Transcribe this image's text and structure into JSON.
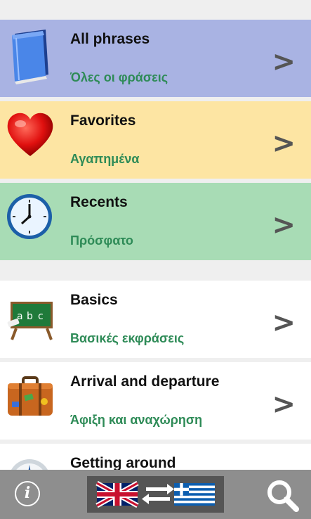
{
  "list": {
    "items": [
      {
        "title": "All phrases",
        "subtitle": "Όλες οι φράσεις",
        "chevron": ">",
        "icon": "book-icon",
        "bg": "#a9b3e3"
      },
      {
        "title": "Favorites",
        "subtitle": "Αγαπημένα",
        "chevron": ">",
        "icon": "heart-icon",
        "bg": "#fde5a3"
      },
      {
        "title": "Recents",
        "subtitle": "Πρόσφατο",
        "chevron": ">",
        "icon": "clock-icon",
        "bg": "#a8dcb5"
      },
      {
        "title": "Basics",
        "subtitle": "Βασικές εκφράσεις",
        "chevron": ">",
        "icon": "chalkboard-icon",
        "bg": "#ffffff"
      },
      {
        "title": "Arrival and departure",
        "subtitle": "Άφιξη και αναχώρηση",
        "chevron": ">",
        "icon": "suitcase-icon",
        "bg": "#ffffff"
      },
      {
        "title": "Getting around",
        "subtitle": "",
        "chevron": ">",
        "icon": "compass-icon",
        "bg": "#ffffff"
      }
    ]
  },
  "bottom_bar": {
    "info_label": "i",
    "info_icon": "info-icon",
    "language_switch_icon": "language-switch-icon",
    "search_icon": "search-icon",
    "colors": {
      "bar": "#8e8e8e",
      "switch_bg": "#555555",
      "subtitle_green": "#2e8b57"
    }
  }
}
